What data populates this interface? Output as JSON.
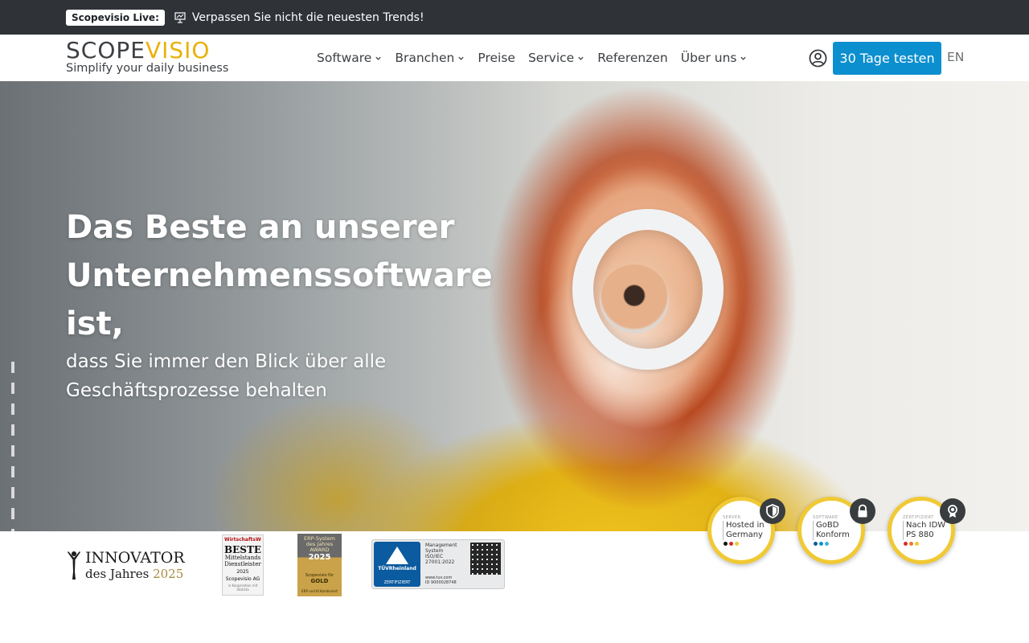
{
  "topbar": {
    "badge": "Scopevisio Live:",
    "icon": "presentation-icon",
    "text": "Verpassen Sie nicht die neuesten Trends!"
  },
  "header": {
    "logo": {
      "word_dark_1": "SCOPE",
      "word_gold": "VISIO",
      "tagline": "Simplify your daily business"
    },
    "nav": [
      {
        "label": "Software",
        "has_dropdown": true
      },
      {
        "label": "Branchen",
        "has_dropdown": true
      },
      {
        "label": "Preise",
        "has_dropdown": false
      },
      {
        "label": "Service",
        "has_dropdown": true
      },
      {
        "label": "Referenzen",
        "has_dropdown": false
      },
      {
        "label": "Über uns",
        "has_dropdown": true
      }
    ],
    "account_icon": "user-circle-icon",
    "cta_label": "30 Tage testen",
    "language": "EN",
    "colors": {
      "cta": "#0c8fcf",
      "logo_gold": "#e9b10a",
      "topbar": "#2f3338"
    }
  },
  "hero": {
    "title_line1": "Das Beste an unserer",
    "title_line2": "Unternehmenssoftware",
    "title_line3": "ist,",
    "subtitle_line1": "dass Sie immer den Blick über alle",
    "subtitle_line2": "Geschäftsprozesse behalten"
  },
  "badges": {
    "innovator": {
      "title": "INNOVATOR",
      "sub": "des Jahres",
      "year": "2025"
    },
    "wiwo": {
      "brand": "WirtschaftsWoche",
      "big": "BESTE",
      "line2": "Mittelstands",
      "line3": "Dienstleister",
      "year": "2025",
      "name": "Scopevisio AG",
      "fine": "in Kooperation mit Statista"
    },
    "erp": {
      "l1": "ERP-System",
      "l2": "des Jahres",
      "award": "AWARD",
      "year": "2025",
      "winner": "Scopevisio für",
      "level": "GOLD",
      "fine": "ERP und KI Kombiniert"
    },
    "tuv": {
      "brand": "TÜVRheinland",
      "cert": "ZERTIFIZIERT",
      "text_1": "Management",
      "text_2": "System",
      "text_3": "ISO/IEC",
      "text_4": "27001:2022",
      "foot_1": "www.tuv.com",
      "foot_2": "ID 9000028748"
    },
    "seals": [
      {
        "caption": "SERVER",
        "line1": "Hosted in",
        "line2": "Germany",
        "icon": "shield-icon"
      },
      {
        "caption": "SOFTWARE",
        "line1": "GoBD",
        "line2": "Konform",
        "icon": "lock-icon"
      },
      {
        "caption": "ZERTIFIZIERT",
        "line1": "Nach IDW",
        "line2": "PS 880",
        "icon": "award-ribbon-icon"
      }
    ]
  }
}
